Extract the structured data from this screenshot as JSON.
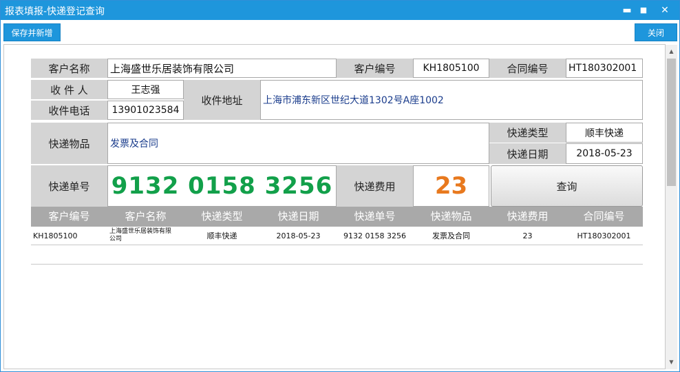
{
  "window": {
    "title": "报表填报-快递登记查询",
    "controls": {
      "minimize": "▬",
      "maximize": "■",
      "close": "✕"
    }
  },
  "toolbar": {
    "save_new_label": "保存并新增",
    "close_label": "关闭"
  },
  "form": {
    "customer_name_label": "客户名称",
    "customer_name": "上海盛世乐居装饰有限公司",
    "customer_no_label": "客户编号",
    "customer_no": "KH1805100",
    "contract_no_label": "合同编号",
    "contract_no": "HT180302001",
    "recipient_label": "收 件 人",
    "recipient": "王志强",
    "recipient_phone_label": "收件电话",
    "recipient_phone": "13901023584",
    "address_label": "收件地址",
    "address": "上海市浦东新区世纪大道1302号A座1002",
    "item_label": "快递物品",
    "item": "发票及合同",
    "courier_type_label": "快递类型",
    "courier_type": "顺丰快递",
    "courier_date_label": "快递日期",
    "courier_date": "2018-05-23",
    "tracking_label": "快递单号",
    "tracking_no": "9132 0158 3256",
    "fee_label": "快递费用",
    "fee": "23",
    "query_label": "查询"
  },
  "grid": {
    "columns": [
      "客户编号",
      "客户名称",
      "快递类型",
      "快递日期",
      "快递单号",
      "快递物品",
      "快递费用",
      "合同编号"
    ],
    "rows": [
      [
        "KH1805100",
        "上海盛世乐居装饰有限公司",
        "顺丰快递",
        "2018-05-23",
        "9132 0158 3256",
        "发票及合同",
        "23",
        "HT180302001"
      ]
    ]
  },
  "colors": {
    "accent": "#1e96dc",
    "tracking": "#12a04a",
    "fee": "#e8791e",
    "label_bg": "#d4d4d4",
    "grid_header_bg": "#a9a9a9"
  }
}
